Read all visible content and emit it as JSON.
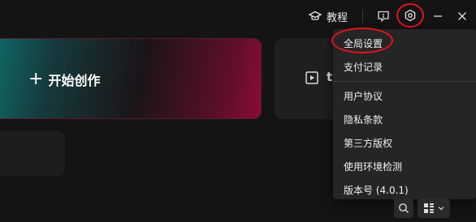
{
  "titlebar": {
    "tutorial_label": "教程"
  },
  "cards": {
    "create_label": "开始创作",
    "second_partial": "t"
  },
  "menu": {
    "items": [
      "全局设置",
      "支付记录",
      "用户协议",
      "隐私条款",
      "第三方版权",
      "使用环境检测",
      "版本号 (4.0.1)"
    ]
  },
  "colors": {
    "background": "#141414",
    "menu_bg": "#252525",
    "annotation_red": "#e0141e",
    "gradient_start": "#0f6b67",
    "gradient_end": "#8a0c36"
  }
}
